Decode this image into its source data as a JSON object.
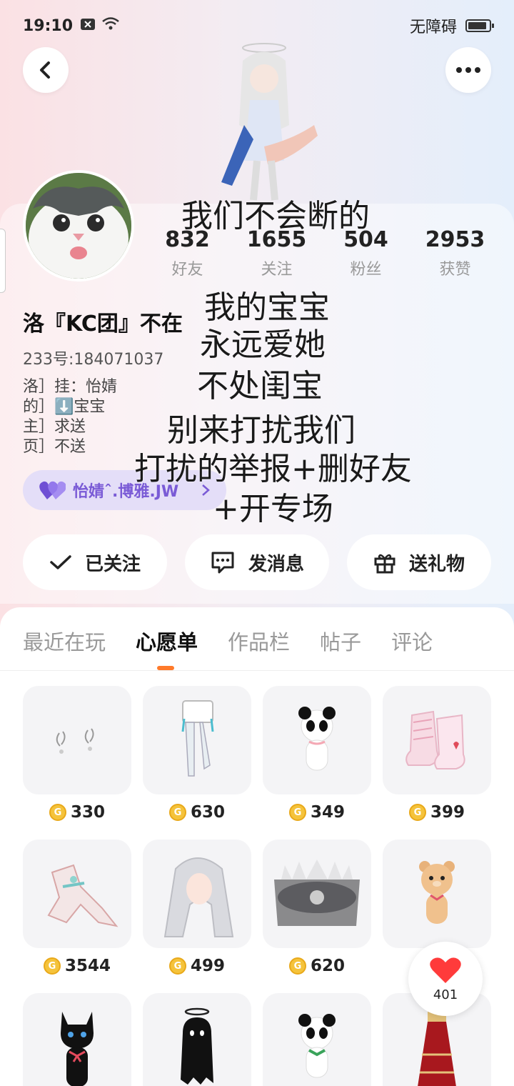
{
  "status_bar": {
    "time": "19:10",
    "accessibility": "无障碍"
  },
  "header": {
    "back_icon": "chevron-left-icon",
    "more_icon": "more-dots-icon"
  },
  "overlay_text": {
    "line1": "我们不会断的",
    "line2": "我的宝宝",
    "line3": "永远爱她",
    "line4": "不处闺宝",
    "line5": "别来打扰我们",
    "line6": "打扰的举报+删好友",
    "line7": "+开专场"
  },
  "stats": [
    {
      "value": "832",
      "label": "好友"
    },
    {
      "value": "1655",
      "label": "关注"
    },
    {
      "value": "504",
      "label": "粉丝"
    },
    {
      "value": "2953",
      "label": "获赞"
    }
  ],
  "profile": {
    "name": "洛『KC团』不在",
    "id": "233号:184071037",
    "bio": [
      "洛］挂：怡婧",
      "的］⬇️宝宝",
      "主］求送",
      "页］不送"
    ]
  },
  "couple_tag": {
    "label": "怡婧ˆ.博雅.JW",
    "accent": "#7a5bd6"
  },
  "actions": {
    "follow": "已关注",
    "message": "发消息",
    "gift": "送礼物"
  },
  "tabs": [
    "最近在玩",
    "心愿单",
    "作品栏",
    "帖子",
    "评论"
  ],
  "active_tab": "心愿单",
  "wishlist": [
    {
      "price": "330",
      "icon": "hair-clips-icon"
    },
    {
      "price": "630",
      "icon": "stockings-icon"
    },
    {
      "price": "349",
      "icon": "panda-plush-icon"
    },
    {
      "price": "399",
      "icon": "boots-icon"
    },
    {
      "price": "3544",
      "icon": "dress-icon"
    },
    {
      "price": "499",
      "icon": "wig-icon"
    },
    {
      "price": "620",
      "icon": "crown-icon"
    },
    {
      "price": "",
      "icon": "bear-plush-icon"
    },
    {
      "price": "",
      "icon": "black-cat-icon"
    },
    {
      "price": "",
      "icon": "ghost-icon"
    },
    {
      "price": "",
      "icon": "panda-icon"
    },
    {
      "price": "",
      "icon": "red-skirt-icon"
    }
  ],
  "like_button": {
    "count": "401",
    "color": "#ff3b3b"
  }
}
